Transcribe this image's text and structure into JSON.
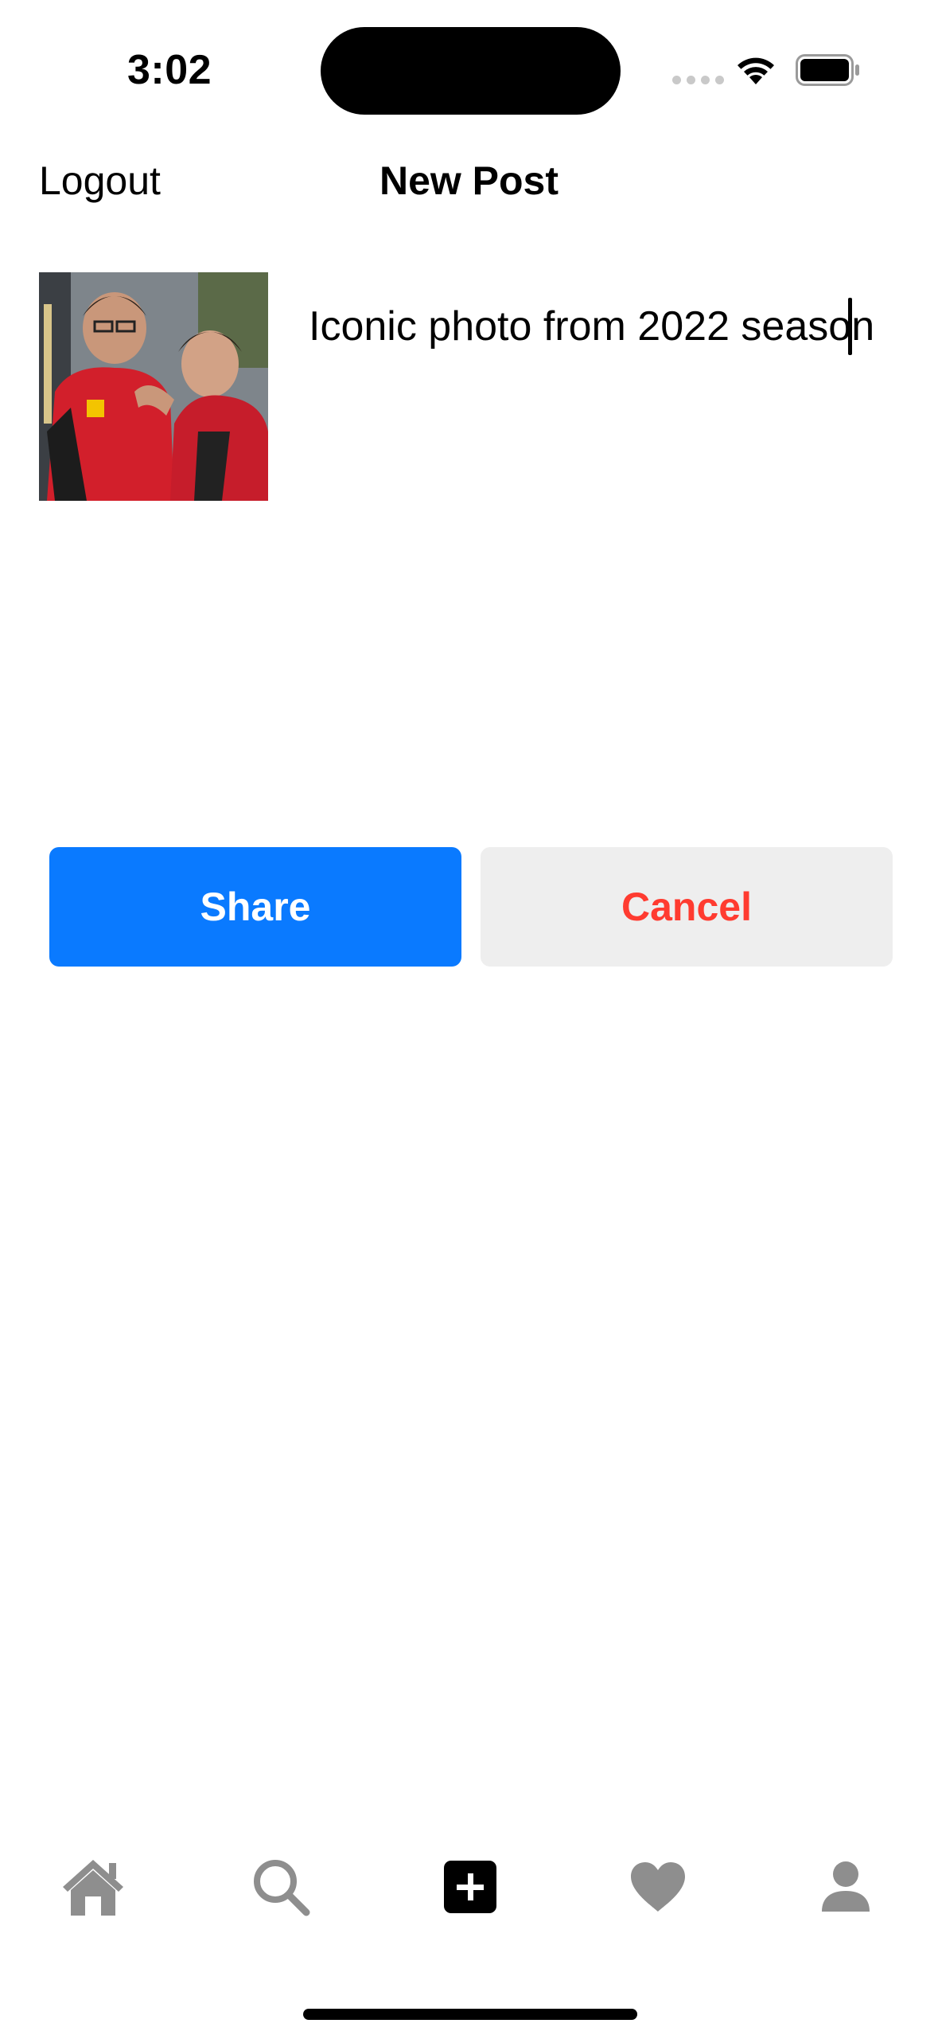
{
  "status_bar": {
    "time": "3:02"
  },
  "header": {
    "logout_label": "Logout",
    "title": "New Post"
  },
  "post": {
    "caption_value": "Iconic photo from 2022 season",
    "photo_icon": "photo-thumbnail"
  },
  "actions": {
    "share_label": "Share",
    "cancel_label": "Cancel"
  },
  "tab_bar": {
    "items": [
      {
        "icon": "house-icon",
        "active": false
      },
      {
        "icon": "magnifying-glass-icon",
        "active": false
      },
      {
        "icon": "plus-square-icon",
        "active": true
      },
      {
        "icon": "heart-icon",
        "active": false
      },
      {
        "icon": "person-icon",
        "active": false
      }
    ]
  },
  "colors": {
    "primary": "#0a7aff",
    "destructive": "#ff3b30",
    "secondary_button": "#eeeeee",
    "inactive_icon": "#8e8e8e",
    "active_icon": "#000000"
  }
}
